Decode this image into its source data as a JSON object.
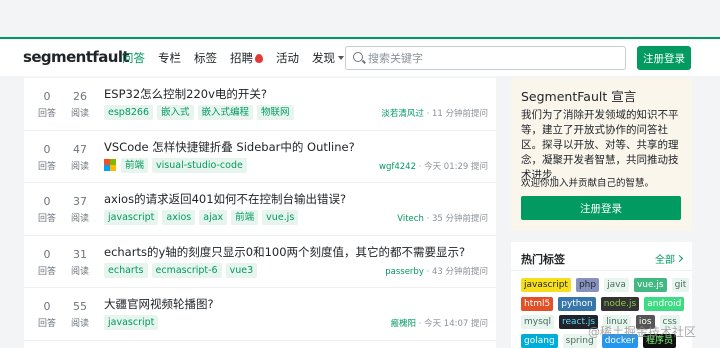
{
  "header": {
    "logo": "segmentfault",
    "nav": [
      "问答",
      "专栏",
      "标签",
      "招聘",
      "活动",
      "发现"
    ],
    "search_placeholder": "搜索关键字",
    "register_label": "注册登录"
  },
  "questions": [
    {
      "answers": "0",
      "answers_label": "回答",
      "views": "26",
      "views_label": "阅读",
      "title": "ESP32怎么控制220v电的开关?",
      "tags": [
        "esp8266",
        "嵌入式",
        "嵌入式编程",
        "物联网"
      ],
      "user": "淡若清风过",
      "time": "· 11 分钟前提问"
    },
    {
      "answers": "0",
      "answers_label": "回答",
      "views": "47",
      "views_label": "阅读",
      "title": "VSCode 怎样快捷键折叠 Sidebar中的 Outline?",
      "tags": [
        "前端",
        "visual-studio-code"
      ],
      "user": "wgf4242",
      "time": "· 今天 01:29 提问"
    },
    {
      "answers": "0",
      "answers_label": "回答",
      "views": "37",
      "views_label": "阅读",
      "title": "axios的请求返回401如何不在控制台输出错误?",
      "tags": [
        "javascript",
        "axios",
        "ajax",
        "前端",
        "vue.js"
      ],
      "user": "Vitech",
      "time": "· 35 分钟前提问"
    },
    {
      "answers": "0",
      "answers_label": "回答",
      "views": "31",
      "views_label": "阅读",
      "title": "echarts的y轴的刻度只显示0和100两个刻度值，其它的都不需要显示?",
      "tags": [
        "echarts",
        "ecmascript-6",
        "vue3"
      ],
      "user": "passerby",
      "time": "· 43 分钟前提问"
    },
    {
      "answers": "0",
      "answers_label": "回答",
      "views": "55",
      "views_label": "阅读",
      "title": "大疆官网视频轮播图?",
      "tags": [
        "javascript"
      ],
      "user": "瘢槐阳",
      "time": "· 今天 14:07 提问"
    }
  ],
  "sidebar": {
    "title": "SegmentFault 宣言",
    "desc": "我们为了消除开发领域的知识不平等，建立了开放式协作的问答社区。探寻以开放、对等、共享的理念，凝聚开发者智慧，共同推动技术进步。",
    "welcome": "欢迎你加入并贡献自己的智慧。",
    "button": "注册登录"
  },
  "hot_tags": {
    "heading": "热门标签",
    "all_label": "全部",
    "rows": [
      [
        {
          "name": "javascript",
          "bg": "#f7df1e",
          "fg": "#212529"
        },
        {
          "name": "php",
          "bg": "#8892bf",
          "fg": "#212529"
        },
        {
          "name": "java",
          "bg": "#e7f5ee",
          "fg": "#4a6b5c"
        },
        {
          "name": "vue.js",
          "bg": "#42b883",
          "fg": "#ffffff"
        },
        {
          "name": "git",
          "bg": "#e7f5ee",
          "fg": "#4a6b5c"
        }
      ],
      [
        {
          "name": "html5",
          "bg": "#e34f26",
          "fg": "#ffffff"
        },
        {
          "name": "python",
          "bg": "#3776ab",
          "fg": "#ffffff"
        },
        {
          "name": "node.js",
          "bg": "#333333",
          "fg": "#8cc84b"
        },
        {
          "name": "android",
          "bg": "#3ddc84",
          "fg": "#ffffff"
        }
      ],
      [
        {
          "name": "mysql",
          "bg": "#e7f5ee",
          "fg": "#4a6b5c"
        },
        {
          "name": "react.js",
          "bg": "#20232a",
          "fg": "#61dafb"
        },
        {
          "name": "linux",
          "bg": "#e7f5ee",
          "fg": "#4a6b5c"
        },
        {
          "name": "ios",
          "bg": "#555555",
          "fg": "#ffffff"
        },
        {
          "name": "css",
          "bg": "#e7f5ee",
          "fg": "#4a6b5c"
        }
      ],
      [
        {
          "name": "golang",
          "bg": "#00add8",
          "fg": "#ffffff"
        },
        {
          "name": "spring",
          "bg": "#e7f5ee",
          "fg": "#4a6b5c"
        },
        {
          "name": "docker",
          "bg": "#2496ed",
          "fg": "#ffffff"
        },
        {
          "name": "程序员",
          "bg": "#111111",
          "fg": "#7fff7f"
        }
      ]
    ]
  },
  "watermark": "@稀土掘金技术社区"
}
